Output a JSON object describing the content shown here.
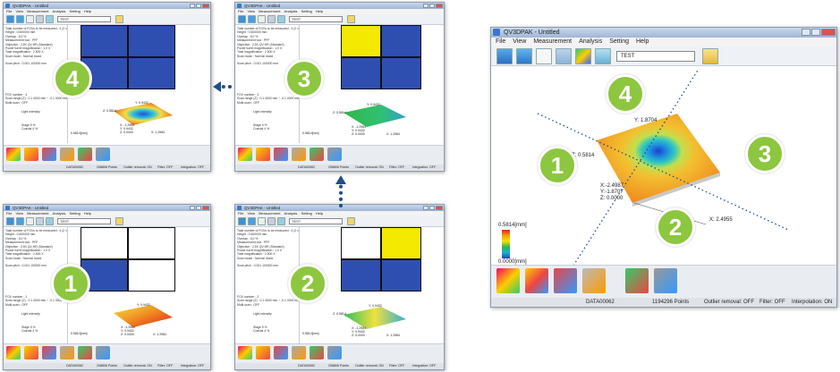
{
  "app": {
    "title": "QV3DPAK - Untitled",
    "small_title": "QV3DPAK - Untitled",
    "menu": [
      "File",
      "View",
      "Measurement",
      "Analysis",
      "Setting",
      "Help"
    ],
    "combo_value": "TEST",
    "small_combo_value": "TEST"
  },
  "steps": [
    {
      "number": "1"
    },
    {
      "number": "2"
    },
    {
      "number": "3"
    },
    {
      "number": "4"
    }
  ],
  "settings_text": [
    "Total number of FOVs to be measured : 4 (2 x 2)",
    "Height : 0.600000 mm",
    "Overlap : 5.0 %",
    "Measurement tool : PFF",
    "Objective : 2.5X QV-HR (Standard)",
    "Power turret magnification : 1.0 X",
    "Total magnification : 2.500 X",
    "Scan mode : Normal mode",
    "Scan pitch : 0.001 100000 mm"
  ],
  "fov_text": {
    "fov_1": "FOV number : 1",
    "fov_2": "FOV number : 2",
    "fov_3": "FOV number : 3",
    "fov_4": "FOV number : 4",
    "scan_range": "Scan range (Z) : 0.1 4000 mm ~ -0.1 0000 mm",
    "multi_scan": "Multi-scan : OFF",
    "light": "Light intensity",
    "stage": "Stage    5 %",
    "coaxial": "Coaxial    4 %"
  },
  "plot_small": {
    "y_label": "Y: 0.9432",
    "z_label": "Z: 0.5814",
    "x_label": "X: 1.2984",
    "coord_x": "X: -1.2984",
    "coord_y": "Y: 0.9432",
    "coord_z": "Z: 0.0000",
    "scale_label": "0.5814[mm]"
  },
  "plot_big": {
    "y_label": "Y: 1.8704",
    "z_label": "Z: 0.5814",
    "x_label": "X: 2.4955",
    "coord_x": "X:-2.4987",
    "coord_y": "Y:-1.8707",
    "coord_z": "Z: 0.0000",
    "scale_top": "0.5814[mm]",
    "scale_bottom": "0.0000[mm]"
  },
  "status": {
    "file": "DATA00062",
    "points": "1194296 Points",
    "outlier": "Outlier removal: OFF",
    "filter": "Filter: OFF",
    "interp": "Interpolation: ON",
    "small_file": "DATA00062",
    "small_points": "208806 Points",
    "small_outlier": "Outlier removal: ON",
    "small_filter": "Filter: OFF",
    "small_interp": "Integration: OFF"
  },
  "colors": {
    "badge": "#8dc63f",
    "quad_blue": "#2f4fb0",
    "quad_yellow": "#f4e900",
    "arrow": "#1f4e8c",
    "scanline": "#1f4e8c"
  },
  "icons": [
    "scan-icon",
    "3d-view-icon",
    "measure-icon",
    "grid-icon",
    "bottle-icon",
    "settings-icon"
  ]
}
